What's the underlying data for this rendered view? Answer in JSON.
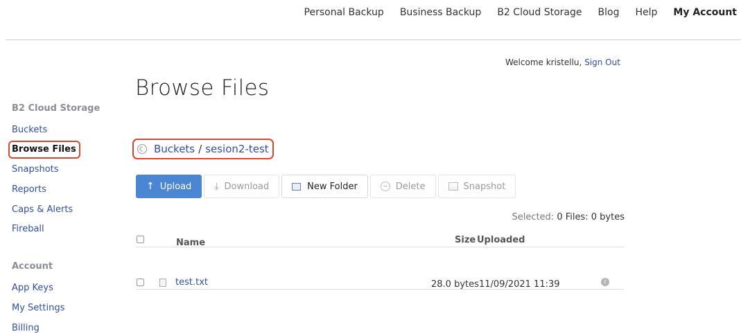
{
  "topnav": {
    "items": [
      "Personal Backup",
      "Business Backup",
      "B2 Cloud Storage",
      "Blog",
      "Help",
      "My Account"
    ]
  },
  "welcome": {
    "text": "Welcome kristellu,",
    "signout": "Sign Out"
  },
  "page_title": "Browse Files",
  "sidebar": {
    "section1": "B2 Cloud Storage",
    "items1": [
      "Buckets",
      "Browse Files",
      "Snapshots",
      "Reports",
      "Caps & Alerts",
      "Fireball"
    ],
    "section2": "Account",
    "items2": [
      "App Keys",
      "My Settings",
      "Billing"
    ]
  },
  "breadcrumb": {
    "root": "Buckets",
    "sep": "/",
    "current": "sesion2-test"
  },
  "toolbar": {
    "upload": "Upload",
    "download": "Download",
    "new_folder": "New Folder",
    "delete": "Delete",
    "snapshot": "Snapshot"
  },
  "selection": {
    "label": "Selected:",
    "value": "0 Files: 0 bytes"
  },
  "table": {
    "headers": {
      "name": "Name",
      "size": "Size",
      "uploaded": "Uploaded"
    },
    "rows": [
      {
        "name": "test.txt",
        "size": "28.0 bytes",
        "uploaded": "11/09/2021 11:39"
      }
    ]
  },
  "colors": {
    "accent": "#4a86d1",
    "link": "#2f4fa3",
    "highlight": "#d9462e"
  },
  "icons": {
    "upload": "arrow-up-icon",
    "download": "download-icon",
    "folder": "new-folder-icon",
    "delete": "minus-circle-icon",
    "snapshot": "image-icon",
    "info": "info-icon"
  }
}
